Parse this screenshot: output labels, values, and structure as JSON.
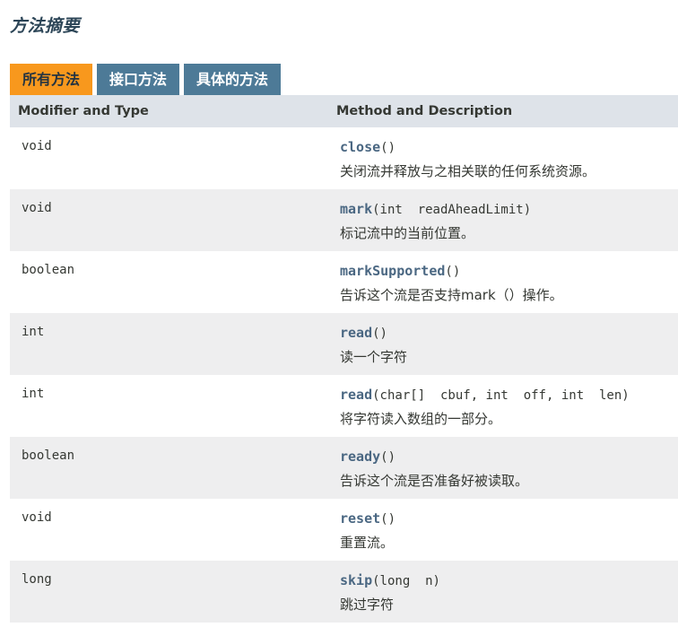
{
  "section": {
    "title": "方法摘要"
  },
  "tabs": [
    {
      "label": "所有方法",
      "active": true
    },
    {
      "label": "接口方法",
      "active": false
    },
    {
      "label": "具体的方法",
      "active": false
    }
  ],
  "table": {
    "headers": [
      "Modifier and Type",
      "Method and Description"
    ],
    "rows": [
      {
        "type": "void",
        "name": "close",
        "params": "()",
        "desc": "关闭流并释放与之相关联的任何系统资源。"
      },
      {
        "type": "void",
        "name": "mark",
        "params": "(int  readAheadLimit)",
        "desc": "标记流中的当前位置。"
      },
      {
        "type": "boolean",
        "name": "markSupported",
        "params": "()",
        "desc": "告诉这个流是否支持mark（）操作。"
      },
      {
        "type": "int",
        "name": "read",
        "params": "()",
        "desc": "读一个字符"
      },
      {
        "type": "int",
        "name": "read",
        "params": "(char[]  cbuf, int  off, int  len)",
        "desc": "将字符读入数组的一部分。"
      },
      {
        "type": "boolean",
        "name": "ready",
        "params": "()",
        "desc": "告诉这个流是否准备好被读取。"
      },
      {
        "type": "void",
        "name": "reset",
        "params": "()",
        "desc": "重置流。"
      },
      {
        "type": "long",
        "name": "skip",
        "params": "(long  n)",
        "desc": "跳过字符"
      }
    ]
  },
  "colors": {
    "tab_active": "#f8981d",
    "tab_inactive": "#4d7a97",
    "header_bg": "#dee3e9",
    "row_alt_bg": "#eeeeef",
    "method_link": "#4a6782"
  }
}
